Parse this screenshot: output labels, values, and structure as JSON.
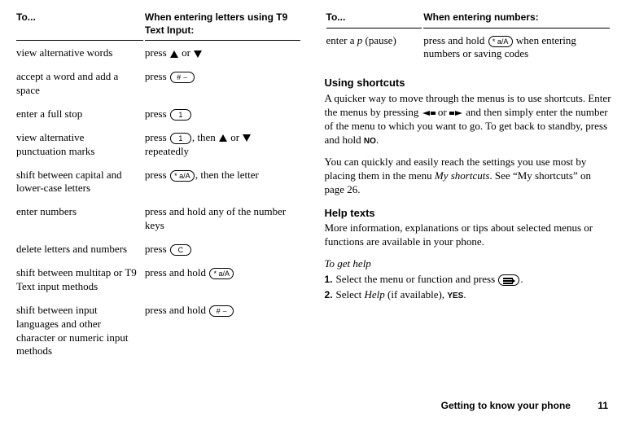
{
  "left_table": {
    "header_to": "To...",
    "header_action": "When entering letters using T9 Text Input:",
    "rows": [
      {
        "to": "view alternative words",
        "action": "press {ARROW_UP} or {ARROW_DOWN}"
      },
      {
        "to": "accept a word and add a space",
        "action": "press {KEY_HASH}"
      },
      {
        "to": "enter a full stop",
        "action": "press {KEY_1}"
      },
      {
        "to": "view alternative punctuation marks",
        "action": "press {KEY_1}, then {ARROW_UP} or {ARROW_DOWN} repeatedly"
      },
      {
        "to": "shift between capital and lower-case letters",
        "action": "press {KEY_STAR}, then the letter"
      },
      {
        "to": "enter numbers",
        "action": "press and hold any of the number keys"
      },
      {
        "to": "delete letters and numbers",
        "action": "press {KEY_C}"
      },
      {
        "to": "shift between multitap or T9 Text input methods",
        "action": "press and hold {KEY_STAR}"
      },
      {
        "to": "shift between input languages and other character or numeric input methods",
        "action": "press and hold {KEY_HASH}"
      }
    ]
  },
  "right_table": {
    "header_to": "To...",
    "header_action": "When entering numbers:",
    "rows": [
      {
        "to": "enter a {IT}p{/IT} (pause)",
        "action": "press and hold {KEY_STAR} when entering numbers or saving codes"
      }
    ]
  },
  "shortcuts": {
    "heading": "Using shortcuts",
    "p1": "A quicker way to move through the menus is to use shortcuts. Enter the menus by pressing {ARROW_LEFT} or {ARROW_RIGHT} and then simply enter the number of the menu to which you want to go. To get back to standby, press and hold {CAP}NO{/CAP}.",
    "p2": "You can quickly and easily reach the settings you use most by placing them in the menu {IT}My shortcuts{/IT}. See “My shortcuts” on page 26."
  },
  "help": {
    "heading": "Help texts",
    "p1": "More information, explanations or tips about selected menus or functions are available in your phone.",
    "subheading": "To get help",
    "step1": "Select the menu or function and press {KEY_MENU}.",
    "step2": "Select {IT}Help{/IT} (if available), {CAP}YES{/CAP}."
  },
  "footer": {
    "chapter": "Getting to know your phone",
    "page": "11"
  }
}
